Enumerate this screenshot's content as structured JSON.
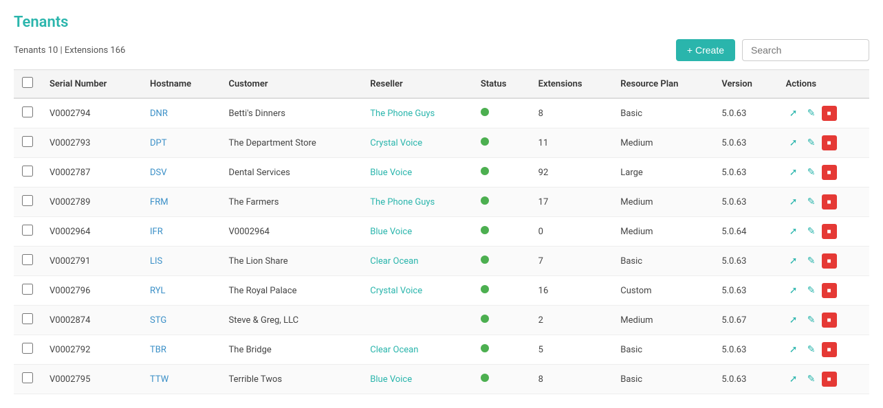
{
  "page": {
    "title": "Tenants",
    "summary": "Tenants 10 | Extensions 166",
    "create_label": "+ Create",
    "search_placeholder": "Search"
  },
  "table": {
    "columns": [
      "",
      "Serial Number",
      "Hostname",
      "Customer",
      "Reseller",
      "Status",
      "Extensions",
      "Resource Plan",
      "Version",
      "Actions"
    ],
    "rows": [
      {
        "serial": "V0002794",
        "hostname": "DNR",
        "customer": "Betti's Dinners",
        "reseller": "The Phone Guys",
        "reseller_class": "teal",
        "status": "active",
        "extensions": "8",
        "resource_plan": "Basic",
        "version": "5.0.63"
      },
      {
        "serial": "V0002793",
        "hostname": "DPT",
        "customer": "The Department Store",
        "reseller": "Crystal Voice",
        "reseller_class": "teal",
        "status": "active",
        "extensions": "11",
        "resource_plan": "Medium",
        "version": "5.0.63"
      },
      {
        "serial": "V0002787",
        "hostname": "DSV",
        "customer": "Dental Services",
        "reseller": "Blue Voice",
        "reseller_class": "teal",
        "status": "active",
        "extensions": "92",
        "resource_plan": "Large",
        "version": "5.0.63"
      },
      {
        "serial": "V0002789",
        "hostname": "FRM",
        "customer": "The Farmers",
        "reseller": "The Phone Guys",
        "reseller_class": "teal",
        "status": "active",
        "extensions": "17",
        "resource_plan": "Medium",
        "version": "5.0.63"
      },
      {
        "serial": "V0002964",
        "hostname": "IFR",
        "customer": "V0002964",
        "reseller": "Blue Voice",
        "reseller_class": "teal",
        "status": "active",
        "extensions": "0",
        "resource_plan": "Medium",
        "version": "5.0.64"
      },
      {
        "serial": "V0002791",
        "hostname": "LIS",
        "customer": "The Lion Share",
        "reseller": "Clear Ocean",
        "reseller_class": "teal",
        "status": "active",
        "extensions": "7",
        "resource_plan": "Basic",
        "version": "5.0.63"
      },
      {
        "serial": "V0002796",
        "hostname": "RYL",
        "customer": "The Royal Palace",
        "reseller": "Crystal Voice",
        "reseller_class": "teal",
        "status": "active",
        "extensions": "16",
        "resource_plan": "Custom",
        "version": "5.0.63"
      },
      {
        "serial": "V0002874",
        "hostname": "STG",
        "customer": "Steve & Greg, LLC",
        "reseller": "",
        "reseller_class": "teal",
        "status": "active",
        "extensions": "2",
        "resource_plan": "Medium",
        "version": "5.0.67"
      },
      {
        "serial": "V0002792",
        "hostname": "TBR",
        "customer": "The Bridge",
        "reseller": "Clear Ocean",
        "reseller_class": "teal",
        "status": "active",
        "extensions": "5",
        "resource_plan": "Basic",
        "version": "5.0.63"
      },
      {
        "serial": "V0002795",
        "hostname": "TTW",
        "customer": "Terrible Twos",
        "reseller": "Blue Voice",
        "reseller_class": "teal",
        "status": "active",
        "extensions": "8",
        "resource_plan": "Basic",
        "version": "5.0.63"
      }
    ]
  }
}
